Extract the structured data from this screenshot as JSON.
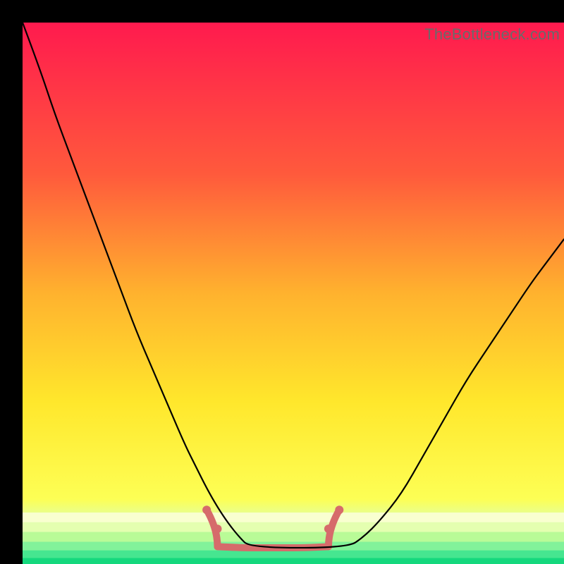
{
  "watermark": {
    "text": "TheBottleneck.com"
  },
  "chart_data": {
    "type": "line",
    "title": "",
    "xlabel": "",
    "ylabel": "",
    "xlim": [
      0,
      100
    ],
    "ylim": [
      0,
      100
    ],
    "grid": false,
    "legend": false,
    "annotations": [],
    "background": {
      "type": "vertical-gradient",
      "stops": [
        {
          "pos": 0.0,
          "color": "#ff1a4e"
        },
        {
          "pos": 0.28,
          "color": "#ff5a3c"
        },
        {
          "pos": 0.5,
          "color": "#ffb22e"
        },
        {
          "pos": 0.7,
          "color": "#ffe72c"
        },
        {
          "pos": 0.88,
          "color": "#fdff55"
        },
        {
          "pos": 0.92,
          "color": "#dfffa7"
        },
        {
          "pos": 0.96,
          "color": "#6df7a0"
        },
        {
          "pos": 1.0,
          "color": "#0cd977"
        }
      ],
      "bottom_stripes": [
        {
          "y": 0.905,
          "h": 0.018,
          "color": "#f9ffd0"
        },
        {
          "y": 0.923,
          "h": 0.018,
          "color": "#e4ffb0"
        },
        {
          "y": 0.941,
          "h": 0.018,
          "color": "#b9fb97"
        },
        {
          "y": 0.959,
          "h": 0.016,
          "color": "#82f29a"
        },
        {
          "y": 0.975,
          "h": 0.014,
          "color": "#46e690"
        },
        {
          "y": 0.989,
          "h": 0.011,
          "color": "#15d87d"
        }
      ]
    },
    "series": [
      {
        "name": "black-curve",
        "color": "#000000",
        "width": 2.2,
        "x": [
          0,
          3,
          6,
          9,
          12,
          15,
          18,
          21,
          24,
          27,
          30,
          32,
          34,
          36,
          38,
          40,
          42,
          60,
          63,
          66,
          70,
          74,
          78,
          82,
          86,
          90,
          94,
          97,
          100
        ],
        "y": [
          100,
          92,
          83,
          75,
          67,
          59,
          51,
          43,
          36,
          29,
          22,
          18,
          14,
          10.5,
          7.5,
          5,
          3,
          3,
          5,
          8,
          13,
          20,
          27,
          34,
          40,
          46,
          52,
          56,
          60
        ]
      }
    ],
    "highlight": {
      "name": "red-trough",
      "color": "#d66b6b",
      "width": 10,
      "caps": [
        {
          "x": 34.0,
          "y": 10.0
        },
        {
          "x": 36.0,
          "y": 6.5
        },
        {
          "x": 56.5,
          "y": 6.5
        },
        {
          "x": 58.5,
          "y": 10.0
        }
      ],
      "base_x": [
        36,
        40,
        44,
        48,
        52,
        56.5
      ],
      "base_y": [
        3.2,
        3.0,
        3.0,
        3.0,
        3.0,
        3.2
      ]
    }
  }
}
